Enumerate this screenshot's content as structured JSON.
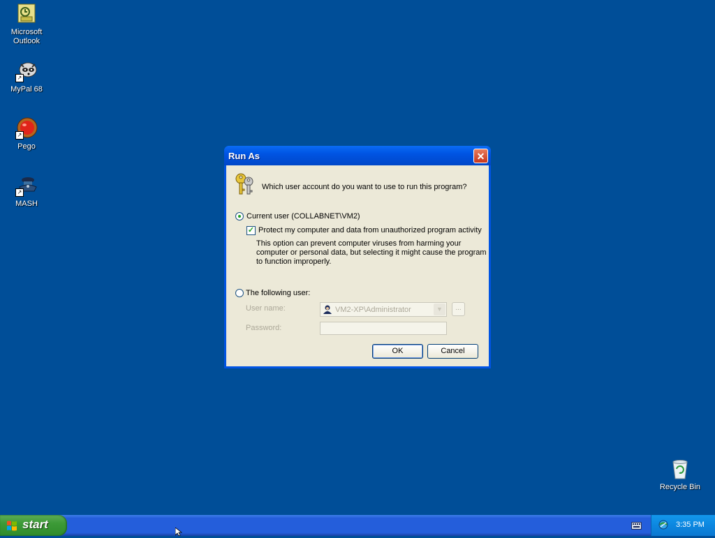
{
  "desktop": {
    "icons": [
      {
        "label_line1": "Microsoft",
        "label_line2": "Outlook"
      },
      {
        "label_line1": "MyPal 68"
      },
      {
        "label_line1": "Pego"
      },
      {
        "label_line1": "MASH"
      },
      {
        "label_line1": "Recycle Bin"
      }
    ]
  },
  "dialog": {
    "title": "Run As",
    "prompt": "Which user account do you want to use to run this program?",
    "current_user_label": "Current user (COLLABNET\\VM2)",
    "current_user_selected": true,
    "protect_label": "Protect my computer and data from unauthorized program activity",
    "protect_checked": true,
    "description_line1": "This option can prevent computer viruses from harming your",
    "description_line2": "computer or personal data, but selecting it might cause the program",
    "description_line3": "to function improperly.",
    "following_user_label": "The following user:",
    "username_label": "User name:",
    "username_value": "VM2-XP\\Administrator",
    "browse_label": "...",
    "password_label": "Password:",
    "ok_label": "OK",
    "cancel_label": "Cancel"
  },
  "taskbar": {
    "start_label": "start",
    "clock": "3:35 PM"
  },
  "colors": {
    "desktop_bg": "#004e98",
    "title_bar": "#0054e3",
    "dialog_face": "#ece9d8",
    "start_green": "#3c9a37"
  }
}
